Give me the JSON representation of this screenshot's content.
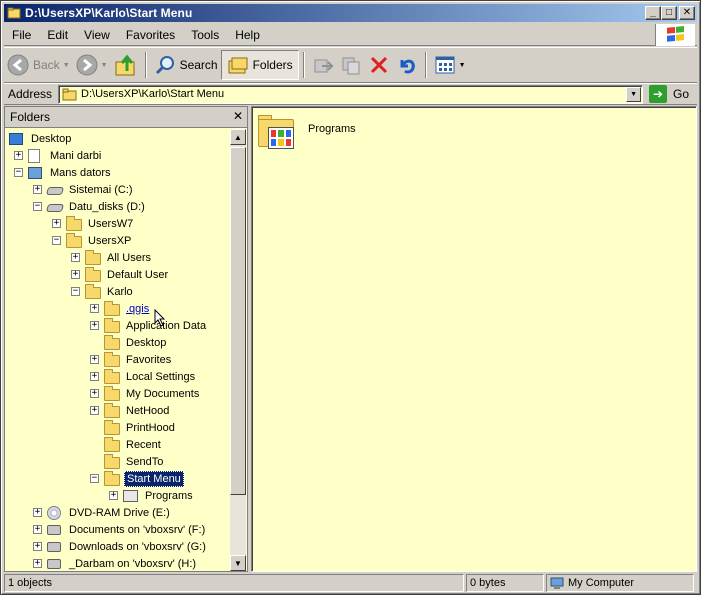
{
  "window": {
    "title": "D:\\UsersXP\\Karlo\\Start Menu",
    "minimize_glyph": "_",
    "maximize_glyph": "□",
    "close_glyph": "✕"
  },
  "menu": [
    "File",
    "Edit",
    "View",
    "Favorites",
    "Tools",
    "Help"
  ],
  "toolbar": {
    "back_label": "Back",
    "search_label": "Search",
    "folders_label": "Folders"
  },
  "address": {
    "label": "Address",
    "value": "D:\\UsersXP\\Karlo\\Start Menu",
    "go_label": "Go"
  },
  "folders_pane": {
    "title": "Folders",
    "close_glyph": "✕",
    "tree": [
      {
        "label": "Desktop",
        "icon": "desktop-icon",
        "expander": "",
        "level": 0
      },
      {
        "label": "Mani darbi",
        "icon": "documents-icon",
        "expander": "+",
        "level": 1
      },
      {
        "label": "Mans dators",
        "icon": "computer-icon",
        "expander": "−",
        "level": 1
      },
      {
        "label": "Sistemai (C:)",
        "icon": "drive-icon",
        "expander": "+",
        "level": 2
      },
      {
        "label": "Datu_disks (D:)",
        "icon": "drive-icon",
        "expander": "−",
        "level": 2
      },
      {
        "label": "UsersW7",
        "icon": "folder-icon",
        "expander": "+",
        "level": 3
      },
      {
        "label": "UsersXP",
        "icon": "folder-icon",
        "expander": "−",
        "level": 3
      },
      {
        "label": "All Users",
        "icon": "folder-icon",
        "expander": "+",
        "level": 4
      },
      {
        "label": "Default User",
        "icon": "folder-icon",
        "expander": "+",
        "level": 4
      },
      {
        "label": "Karlo",
        "icon": "folder-icon",
        "expander": "−",
        "level": 4
      },
      {
        "label": ".qgis",
        "icon": "folder-icon",
        "expander": "+",
        "level": 5,
        "state": "hover"
      },
      {
        "label": "Application Data",
        "icon": "folder-icon",
        "expander": "+",
        "level": 5
      },
      {
        "label": "Desktop",
        "icon": "folder-icon",
        "expander": "",
        "level": 5
      },
      {
        "label": "Favorites",
        "icon": "folder-icon",
        "expander": "+",
        "level": 5
      },
      {
        "label": "Local Settings",
        "icon": "folder-icon",
        "expander": "+",
        "level": 5
      },
      {
        "label": "My Documents",
        "icon": "folder-icon",
        "expander": "+",
        "level": 5
      },
      {
        "label": "NetHood",
        "icon": "folder-icon",
        "expander": "+",
        "level": 5
      },
      {
        "label": "PrintHood",
        "icon": "folder-icon",
        "expander": "",
        "level": 5
      },
      {
        "label": "Recent",
        "icon": "folder-icon",
        "expander": "",
        "level": 5
      },
      {
        "label": "SendTo",
        "icon": "folder-icon",
        "expander": "",
        "level": 5
      },
      {
        "label": "Start Menu",
        "icon": "folder-icon",
        "expander": "−",
        "level": 5,
        "state": "selected"
      },
      {
        "label": "Programs",
        "icon": "programs-icon",
        "expander": "+",
        "level": 6
      },
      {
        "label": "DVD-RAM Drive (E:)",
        "icon": "cd-drive-icon",
        "expander": "+",
        "level": 2
      },
      {
        "label": "Documents on 'vboxsrv' (F:)",
        "icon": "network-drive-icon",
        "expander": "+",
        "level": 2
      },
      {
        "label": "Downloads on 'vboxsrv' (G:)",
        "icon": "network-drive-icon",
        "expander": "+",
        "level": 2
      },
      {
        "label": "_Darbam on 'vboxsrv' (H:)",
        "icon": "network-drive-icon",
        "expander": "+",
        "level": 2
      }
    ],
    "scroll": {
      "up_glyph": "▲",
      "down_glyph": "▼"
    }
  },
  "content": {
    "items": [
      {
        "label": "Programs",
        "icon": "programs-folder-icon"
      }
    ]
  },
  "status": {
    "objects": "1 objects",
    "size": "0 bytes",
    "zone": "My Computer"
  },
  "colors": {
    "title_start": "#0a246a",
    "title_end": "#a6caf0",
    "pane_bg": "#ffffc8",
    "selection": "#0a246a"
  }
}
